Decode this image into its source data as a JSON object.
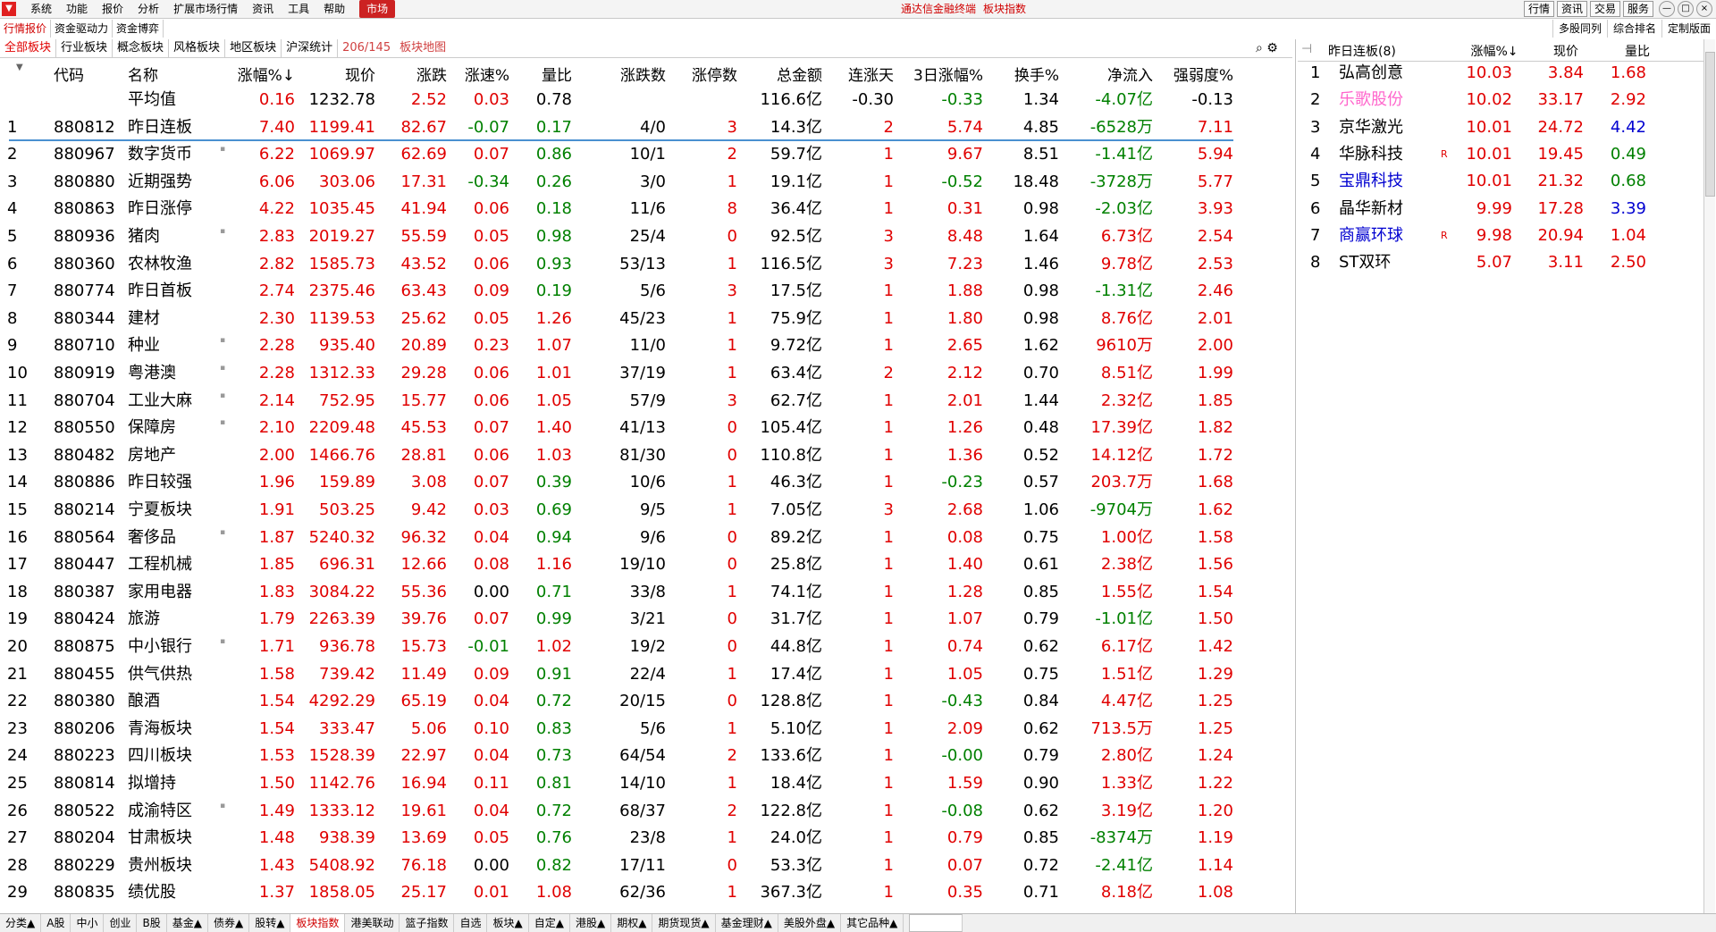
{
  "menu": {
    "logo": "▼",
    "items": [
      "系统",
      "功能",
      "报价",
      "分析",
      "扩展市场行情",
      "资讯",
      "工具",
      "帮助"
    ],
    "active": "市场"
  },
  "app_title": [
    "通达信金融终端",
    "板块指数"
  ],
  "right_buttons": [
    "行情",
    "资讯",
    "交易",
    "服务"
  ],
  "window_buttons": [
    "—",
    "□",
    "×"
  ],
  "tabs_top": [
    "行情报价",
    "资金驱动力",
    "资金博弈"
  ],
  "tabs_top_right": [
    "多股同列",
    "综合排名",
    "定制版面"
  ],
  "tabs_second": [
    "全部板块",
    "行业板块",
    "概念板块",
    "风格板块",
    "地区板块",
    "沪深统计"
  ],
  "tabs_second_count": "206/145",
  "tabs_second_map": "板块地图",
  "main_table": {
    "headers": [
      "代码",
      "名称",
      "涨幅%↓",
      "现价",
      "涨跌",
      "涨速%",
      "量比",
      "涨跌数",
      "涨停数",
      "总金额",
      "连涨天",
      "3日涨幅%",
      "换手%",
      "净流入",
      "强弱度%"
    ],
    "average": {
      "name": "平均值",
      "change_pct": "0.16",
      "price": "1232.78",
      "change": "2.52",
      "speed": "0.03",
      "vol_ratio": "0.78",
      "amount": "116.6亿",
      "days": "-0.30",
      "chg3": "-0.33",
      "turnover": "1.34",
      "inflow": "-4.07亿",
      "strength": "-0.13"
    },
    "rows": [
      [
        "1",
        "880812",
        "昨日连板",
        "",
        "7.40",
        "1199.41",
        "82.67",
        "-0.07",
        "0.17",
        "4/0",
        "3",
        "14.3亿",
        "2",
        "5.74",
        "4.85",
        "-6528万",
        "7.11"
      ],
      [
        "2",
        "880967",
        "数字货币",
        "▪",
        "6.22",
        "1069.97",
        "62.69",
        "0.07",
        "0.86",
        "10/1",
        "2",
        "59.7亿",
        "1",
        "9.67",
        "8.51",
        "-1.41亿",
        "5.94"
      ],
      [
        "3",
        "880880",
        "近期强势",
        "",
        "6.06",
        "303.06",
        "17.31",
        "-0.34",
        "0.26",
        "3/0",
        "1",
        "19.1亿",
        "1",
        "-0.52",
        "18.48",
        "-3728万",
        "5.77"
      ],
      [
        "4",
        "880863",
        "昨日涨停",
        "",
        "4.22",
        "1035.45",
        "41.94",
        "0.06",
        "0.18",
        "11/6",
        "8",
        "36.4亿",
        "1",
        "0.31",
        "0.98",
        "-2.03亿",
        "3.93"
      ],
      [
        "5",
        "880936",
        "猪肉",
        "▪",
        "2.83",
        "2019.27",
        "55.59",
        "0.05",
        "0.98",
        "25/4",
        "0",
        "92.5亿",
        "3",
        "8.48",
        "1.64",
        "6.73亿",
        "2.54"
      ],
      [
        "6",
        "880360",
        "农林牧渔",
        "",
        "2.82",
        "1585.73",
        "43.52",
        "0.06",
        "0.93",
        "53/13",
        "1",
        "116.5亿",
        "3",
        "7.23",
        "1.46",
        "9.78亿",
        "2.53"
      ],
      [
        "7",
        "880774",
        "昨日首板",
        "",
        "2.74",
        "2375.46",
        "63.43",
        "0.09",
        "0.19",
        "5/6",
        "3",
        "17.5亿",
        "1",
        "1.88",
        "0.98",
        "-1.31亿",
        "2.46"
      ],
      [
        "8",
        "880344",
        "建材",
        "",
        "2.30",
        "1139.53",
        "25.62",
        "0.05",
        "1.26",
        "45/23",
        "1",
        "75.9亿",
        "1",
        "1.80",
        "0.98",
        "8.76亿",
        "2.01"
      ],
      [
        "9",
        "880710",
        "种业",
        "▪",
        "2.28",
        "935.40",
        "20.89",
        "0.23",
        "1.07",
        "11/0",
        "1",
        "9.72亿",
        "1",
        "2.65",
        "1.62",
        "9610万",
        "2.00"
      ],
      [
        "10",
        "880919",
        "粤港澳",
        "▪",
        "2.28",
        "1312.33",
        "29.28",
        "0.06",
        "1.01",
        "37/19",
        "1",
        "63.4亿",
        "2",
        "2.12",
        "0.70",
        "8.51亿",
        "1.99"
      ],
      [
        "11",
        "880704",
        "工业大麻",
        "▪",
        "2.14",
        "752.95",
        "15.77",
        "0.06",
        "1.05",
        "57/9",
        "3",
        "62.7亿",
        "1",
        "2.01",
        "1.44",
        "2.32亿",
        "1.85"
      ],
      [
        "12",
        "880550",
        "保障房",
        "▪",
        "2.10",
        "2209.48",
        "45.53",
        "0.07",
        "1.40",
        "41/13",
        "0",
        "105.4亿",
        "1",
        "1.26",
        "0.48",
        "17.39亿",
        "1.82"
      ],
      [
        "13",
        "880482",
        "房地产",
        "",
        "2.00",
        "1466.76",
        "28.81",
        "0.06",
        "1.03",
        "81/30",
        "0",
        "110.8亿",
        "1",
        "1.36",
        "0.52",
        "14.12亿",
        "1.72"
      ],
      [
        "14",
        "880886",
        "昨日较强",
        "",
        "1.96",
        "159.89",
        "3.08",
        "0.07",
        "0.39",
        "10/6",
        "1",
        "46.3亿",
        "1",
        "-0.23",
        "0.57",
        "203.7万",
        "1.68"
      ],
      [
        "15",
        "880214",
        "宁夏板块",
        "",
        "1.91",
        "503.25",
        "9.42",
        "0.03",
        "0.69",
        "9/5",
        "1",
        "7.05亿",
        "3",
        "2.68",
        "1.06",
        "-9704万",
        "1.62"
      ],
      [
        "16",
        "880564",
        "奢侈品",
        "▪",
        "1.87",
        "5240.32",
        "96.32",
        "0.04",
        "0.94",
        "9/6",
        "0",
        "89.2亿",
        "1",
        "0.08",
        "0.75",
        "1.00亿",
        "1.58"
      ],
      [
        "17",
        "880447",
        "工程机械",
        "",
        "1.85",
        "696.31",
        "12.66",
        "0.08",
        "1.16",
        "19/10",
        "0",
        "25.8亿",
        "1",
        "1.40",
        "0.61",
        "2.38亿",
        "1.56"
      ],
      [
        "18",
        "880387",
        "家用电器",
        "",
        "1.83",
        "3084.22",
        "55.36",
        "0.00",
        "0.71",
        "33/8",
        "1",
        "74.1亿",
        "1",
        "1.28",
        "0.85",
        "1.55亿",
        "1.54"
      ],
      [
        "19",
        "880424",
        "旅游",
        "",
        "1.79",
        "2263.39",
        "39.76",
        "0.07",
        "0.99",
        "3/21",
        "0",
        "31.7亿",
        "1",
        "1.07",
        "0.79",
        "-1.01亿",
        "1.50"
      ],
      [
        "20",
        "880875",
        "中小银行",
        "▪",
        "1.71",
        "936.78",
        "15.73",
        "-0.01",
        "1.02",
        "19/2",
        "0",
        "44.8亿",
        "1",
        "0.74",
        "0.62",
        "6.17亿",
        "1.42"
      ],
      [
        "21",
        "880455",
        "供气供热",
        "",
        "1.58",
        "739.42",
        "11.49",
        "0.09",
        "0.91",
        "22/4",
        "1",
        "17.4亿",
        "1",
        "1.05",
        "0.75",
        "1.51亿",
        "1.29"
      ],
      [
        "22",
        "880380",
        "酿酒",
        "",
        "1.54",
        "4292.29",
        "65.19",
        "0.04",
        "0.72",
        "20/15",
        "0",
        "128.8亿",
        "1",
        "-0.43",
        "0.84",
        "4.47亿",
        "1.25"
      ],
      [
        "23",
        "880206",
        "青海板块",
        "",
        "1.54",
        "333.47",
        "5.06",
        "0.10",
        "0.83",
        "5/6",
        "1",
        "5.10亿",
        "1",
        "2.09",
        "0.62",
        "713.5万",
        "1.25"
      ],
      [
        "24",
        "880223",
        "四川板块",
        "",
        "1.53",
        "1528.39",
        "22.97",
        "0.04",
        "0.73",
        "64/54",
        "2",
        "133.6亿",
        "1",
        "-0.00",
        "0.79",
        "2.80亿",
        "1.24"
      ],
      [
        "25",
        "880814",
        "拟增持",
        "",
        "1.50",
        "1142.76",
        "16.94",
        "0.11",
        "0.81",
        "14/10",
        "1",
        "18.4亿",
        "1",
        "1.59",
        "0.90",
        "1.33亿",
        "1.22"
      ],
      [
        "26",
        "880522",
        "成渝特区",
        "▪",
        "1.49",
        "1333.12",
        "19.61",
        "0.04",
        "0.72",
        "68/37",
        "2",
        "122.8亿",
        "1",
        "-0.08",
        "0.62",
        "3.19亿",
        "1.20"
      ],
      [
        "27",
        "880204",
        "甘肃板块",
        "",
        "1.48",
        "938.39",
        "13.69",
        "0.05",
        "0.76",
        "23/8",
        "1",
        "24.0亿",
        "1",
        "0.79",
        "0.85",
        "-8374万",
        "1.19"
      ],
      [
        "28",
        "880229",
        "贵州板块",
        "",
        "1.43",
        "5408.92",
        "76.18",
        "0.00",
        "0.82",
        "17/11",
        "0",
        "53.3亿",
        "1",
        "0.07",
        "0.72",
        "-2.41亿",
        "1.14"
      ],
      [
        "29",
        "880835",
        "绩优股",
        "",
        "1.37",
        "1858.05",
        "25.17",
        "0.01",
        "1.08",
        "62/36",
        "1",
        "367.3亿",
        "1",
        "0.35",
        "0.71",
        "8.18亿",
        "1.08"
      ]
    ]
  },
  "right_panel": {
    "title": "昨日连板(8)",
    "pin_icon": "⊣",
    "headers": [
      "涨幅%↓",
      "现价",
      "量比"
    ],
    "rows": [
      {
        "n": "1",
        "name": "弘高创意",
        "mark": "",
        "chg": "10.03",
        "price": "3.84",
        "vr": "1.68",
        "name_color": "black",
        "vr_color": "red"
      },
      {
        "n": "2",
        "name": "乐歌股份",
        "mark": "",
        "chg": "10.02",
        "price": "33.17",
        "vr": "2.92",
        "name_color": "pink",
        "vr_color": "red"
      },
      {
        "n": "3",
        "name": "京华激光",
        "mark": "",
        "chg": "10.01",
        "price": "24.72",
        "vr": "4.42",
        "name_color": "black",
        "vr_color": "blue"
      },
      {
        "n": "4",
        "name": "华脉科技",
        "mark": "R",
        "chg": "10.01",
        "price": "19.45",
        "vr": "0.49",
        "name_color": "black",
        "vr_color": "green"
      },
      {
        "n": "5",
        "name": "宝鼎科技",
        "mark": "",
        "chg": "10.01",
        "price": "21.32",
        "vr": "0.68",
        "name_color": "blue",
        "vr_color": "green"
      },
      {
        "n": "6",
        "name": "晶华新材",
        "mark": "",
        "chg": "9.99",
        "price": "17.28",
        "vr": "3.39",
        "name_color": "black",
        "vr_color": "blue"
      },
      {
        "n": "7",
        "name": "商赢环球",
        "mark": "R",
        "chg": "9.98",
        "price": "20.94",
        "vr": "1.04",
        "name_color": "blue",
        "vr_color": "red"
      },
      {
        "n": "8",
        "name": "ST双环",
        "mark": "",
        "chg": "5.07",
        "price": "3.11",
        "vr": "2.50",
        "name_color": "black",
        "vr_color": "red"
      }
    ]
  },
  "bottom_tabs": [
    "分类▲",
    "A股",
    "中小",
    "创业",
    "B股",
    "基金▲",
    "债券▲",
    "股转▲",
    "板块指数",
    "港美联动",
    "篮子指数",
    "自选",
    "板块▲",
    "自定▲",
    "港股▲",
    "期权▲",
    "期货现货▲",
    "基金理财▲",
    "美股外盘▲",
    "其它品种▲"
  ],
  "bottom_active": "板块指数",
  "colors": {
    "up": "#e00000",
    "down": "#008000",
    "accent": "#cc2222",
    "blue": "#0000d0"
  }
}
